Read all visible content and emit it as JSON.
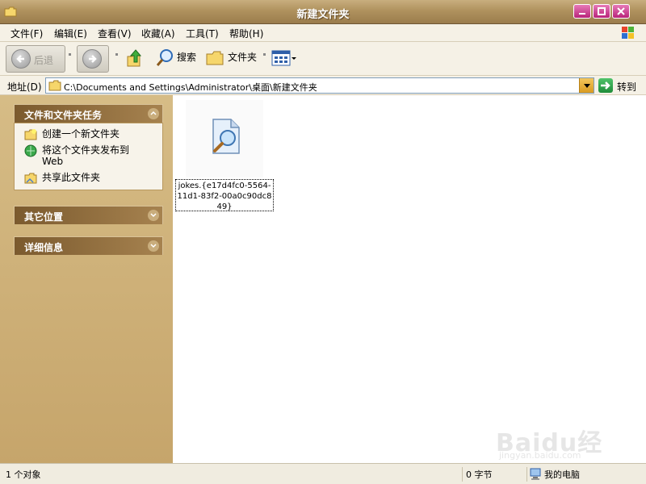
{
  "window": {
    "title": "新建文件夹"
  },
  "menu": [
    "文件(F)",
    "编辑(E)",
    "查看(V)",
    "收藏(A)",
    "工具(T)",
    "帮助(H)"
  ],
  "toolbar": {
    "back_label": "后退",
    "search_label": "搜索",
    "folders_label": "文件夹"
  },
  "address": {
    "label": "地址(D)",
    "value": "C:\\Documents and Settings\\Administrator\\桌面\\新建文件夹",
    "go_label": "转到"
  },
  "left_pane": {
    "tasks_title": "文件和文件夹任务",
    "tasks": [
      {
        "label": "创建一个新文件夹",
        "icon": "new-folder-icon"
      },
      {
        "label": "将这个文件夹发布到",
        "sub": "Web",
        "icon": "publish-web-icon"
      },
      {
        "label": "共享此文件夹",
        "icon": "share-folder-icon"
      }
    ],
    "other_places_title": "其它位置",
    "details_title": "详细信息"
  },
  "files": [
    {
      "name": "jokes.{e17d4fc0-5564-11d1-83f2-00a0c90dc849}",
      "icon": "search-document-icon"
    }
  ],
  "watermark": {
    "logo": "Baidu经验",
    "sub": "jingyan.baidu.com"
  },
  "status": {
    "objects": "1 个对象",
    "size": "0 字节",
    "location": "我的电脑"
  },
  "colors": {
    "title_bar": "#b0925e",
    "left_pane": "#c6a56b",
    "panel_header": "#7b5a2e",
    "close_button": "#b8247a"
  }
}
